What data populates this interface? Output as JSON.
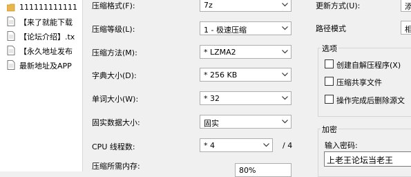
{
  "file_list": {
    "items": [
      {
        "name": "111111111111",
        "icon": "folder-icon"
      },
      {
        "name": "【来了就能下载",
        "icon": "document-icon"
      },
      {
        "name": "【论坛介绍】.tx",
        "icon": "document-icon"
      },
      {
        "name": "【永久地址发布",
        "icon": "document-icon"
      },
      {
        "name": "最新地址及APP",
        "icon": "document-icon"
      }
    ]
  },
  "settings": {
    "format": {
      "label": "压缩格式(F):",
      "value": "7z"
    },
    "level": {
      "label": "压缩等级(L):",
      "value": "1 - 极速压缩"
    },
    "method": {
      "label": "压缩方法(M):",
      "value": "* LZMA2"
    },
    "dict": {
      "label": "字典大小(D):",
      "value": "* 256 KB"
    },
    "word": {
      "label": "单词大小(W):",
      "value": "* 32"
    },
    "solid": {
      "label": "固实数据大小:",
      "value": "固实"
    },
    "threads": {
      "label": "CPU 线程数:",
      "value": "* 4",
      "suffix": "/ 4"
    },
    "memory": {
      "label": "压缩所需内存:",
      "value": "80%"
    }
  },
  "right": {
    "update": {
      "label": "更新方式(U):",
      "value": "添"
    },
    "path": {
      "label": "路径模式",
      "value": "相"
    },
    "options": {
      "title": "选项",
      "items": [
        {
          "label": "创建自解压程序(X)",
          "checked": false
        },
        {
          "label": "压缩共享文件",
          "checked": false
        },
        {
          "label": "操作完成后删除源文",
          "checked": false
        }
      ]
    },
    "encrypt": {
      "title": "加密",
      "password_label": "输入密码:",
      "password_value": "上老王论坛当老王"
    }
  },
  "colors": {
    "folder": "#e8b64c",
    "window_bg": "#f0f0f0",
    "field_border": "#adadad"
  }
}
